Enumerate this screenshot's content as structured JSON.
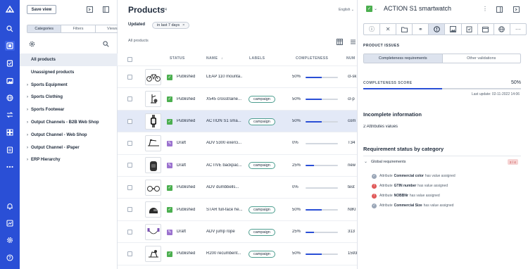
{
  "rail": {
    "icons": [
      "logo-icon",
      "search-icon",
      "products-icon",
      "tasks-icon",
      "assets-icon",
      "channels-icon",
      "transfer-icon",
      "structure-icon",
      "reports-icon",
      "list-icon",
      "more-icon",
      "notifications-icon",
      "dashboard-icon",
      "settings-icon",
      "help-icon"
    ]
  },
  "tree": {
    "save_view_label": "Save view",
    "tabs": [
      "Categories",
      "Filters",
      "Views"
    ],
    "items": [
      {
        "label": "All products",
        "caret": false
      },
      {
        "label": "Unassigned products",
        "caret": false
      },
      {
        "label": "Sports Equipment",
        "caret": true
      },
      {
        "label": "Sports Clothing",
        "caret": true
      },
      {
        "label": "Sports Footwear",
        "caret": true
      },
      {
        "label": "Output Channels - B2B Web Shop",
        "caret": true
      },
      {
        "label": "Output Channel - Web Shop",
        "caret": true
      },
      {
        "label": "Output Channel - iPaper",
        "caret": true
      },
      {
        "label": "ERP Hierarchy",
        "caret": true
      }
    ]
  },
  "main": {
    "title": "Products",
    "count": "24",
    "language": "English",
    "updated_label": "Updated",
    "filter_chip": "in last 7 days",
    "breadcrumb": "All products",
    "columns": {
      "status": "STATUS",
      "name": "NAME",
      "labels": "LABELS",
      "completeness": "COMPLETENESS",
      "number": "NUM"
    },
    "rows": [
      {
        "status": "Published",
        "name": "LEAP 110 mounta...",
        "label": "",
        "completeness": "50%",
        "number": "cl-sk"
      },
      {
        "status": "Published",
        "name": "X545 crosstraine...",
        "label": "campaign",
        "completeness": "50%",
        "number": "cl-p"
      },
      {
        "status": "Published",
        "name": "ACTION S1 sma...",
        "label": "campaign",
        "completeness": "50%",
        "number": "com"
      },
      {
        "status": "Draft",
        "name": "ADV 5300 exerci...",
        "label": "",
        "completeness": "0%",
        "number": "T34"
      },
      {
        "status": "Draft",
        "name": "ACTIVE backpac...",
        "label": "campaign",
        "completeness": "25%",
        "number": "new"
      },
      {
        "status": "Published",
        "name": "ADV dumbbells...",
        "label": "",
        "completeness": "0%",
        "number": "test"
      },
      {
        "status": "Published",
        "name": "STAR full-face he...",
        "label": "campaign",
        "completeness": "50%",
        "number": "NIKI"
      },
      {
        "status": "Draft",
        "name": "ADV jump rope",
        "label": "campaign",
        "completeness": "25%",
        "number": "313"
      },
      {
        "status": "Published",
        "name": "R200 recumbent...",
        "label": "campaign",
        "completeness": "50%",
        "number": "1593"
      }
    ]
  },
  "detail": {
    "title": "ACTION S1 smartwatch",
    "section_label": "PRODUCT ISSUES",
    "subtabs": [
      "Completeness requirements",
      "Other validations"
    ],
    "score_label": "COMPLETENESS SCORE",
    "score_value": "50%",
    "score_fraction": 0.5,
    "last_update": "Last update: 02-11-2022 14:06",
    "incomplete_title": "Incomplete information",
    "incomplete_value": "2 Attributes values",
    "req_title": "Requirement status by category",
    "group_label": "Global requirements",
    "group_badge": "2 / 4",
    "requirements": [
      {
        "prefix": "Attribute",
        "attr": "Commercial color",
        "suffix": "has value assigned",
        "ok": true
      },
      {
        "prefix": "Attribute",
        "attr": "GTIN number",
        "suffix": "has value assigned",
        "ok": false
      },
      {
        "prefix": "Attribute",
        "attr": "NOBBNr",
        "suffix": "has value assigned",
        "ok": false
      },
      {
        "prefix": "Attribute",
        "attr": "Commercial Size",
        "suffix": "has value assigned",
        "ok": true
      }
    ]
  },
  "colors": {
    "accent": "#2a4fd6",
    "published": "#4caf50",
    "draft": "#9b72cf",
    "error": "#e05a5a",
    "ok": "#9aa6b7",
    "tag_border": "#4d9e8f"
  }
}
